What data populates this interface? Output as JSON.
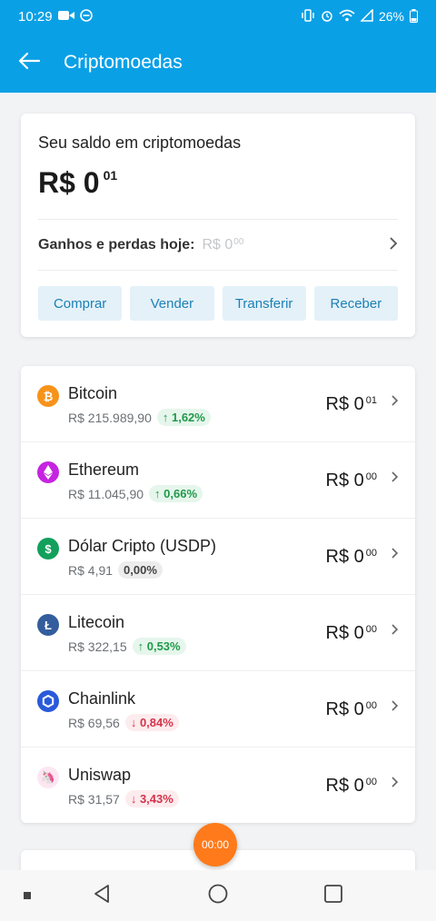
{
  "status_bar": {
    "time": "10:29",
    "battery": "26%"
  },
  "app_bar": {
    "title": "Criptomoedas"
  },
  "balance": {
    "title": "Seu saldo em criptomoedas",
    "value_main": "R$ 0",
    "value_cents": "01",
    "gains_label": "Ganhos e perdas hoje:",
    "gains_main": "R$ 0",
    "gains_cents": "00",
    "actions": [
      "Comprar",
      "Vender",
      "Transferir",
      "Receber"
    ]
  },
  "coins": [
    {
      "name": "Bitcoin",
      "price": "R$ 215.989,90",
      "change": "↑ 1,62%",
      "trend": "up",
      "value_main": "R$ 0",
      "value_cents": "01",
      "icon": "bitcoin-icon",
      "color": "#f7931a"
    },
    {
      "name": "Ethereum",
      "price": "R$ 11.045,90",
      "change": "↑ 0,66%",
      "trend": "up",
      "value_main": "R$ 0",
      "value_cents": "00",
      "icon": "ethereum-icon",
      "color": "#c524e0"
    },
    {
      "name": "Dólar Cripto (USDP)",
      "price": "R$ 4,91",
      "change": "0,00%",
      "trend": "flat",
      "value_main": "R$ 0",
      "value_cents": "00",
      "icon": "dollar-icon",
      "color": "#12a05c"
    },
    {
      "name": "Litecoin",
      "price": "R$ 322,15",
      "change": "↑ 0,53%",
      "trend": "up",
      "value_main": "R$ 0",
      "value_cents": "00",
      "icon": "litecoin-icon",
      "color": "#345d9d"
    },
    {
      "name": "Chainlink",
      "price": "R$ 69,56",
      "change": "↓ 0,84%",
      "trend": "down",
      "value_main": "R$ 0",
      "value_cents": "00",
      "icon": "chainlink-icon",
      "color": "#2a5ada"
    },
    {
      "name": "Uniswap",
      "price": "R$ 31,57",
      "change": "↓ 3,43%",
      "trend": "down",
      "value_main": "R$ 0",
      "value_cents": "00",
      "icon": "uniswap-icon",
      "color": "#ff007a"
    }
  ],
  "timer": "00:00",
  "colors": {
    "primary": "#0aa0e6",
    "up": "#1f9a4a",
    "down": "#d6334a",
    "timer": "#ff7a1a"
  }
}
